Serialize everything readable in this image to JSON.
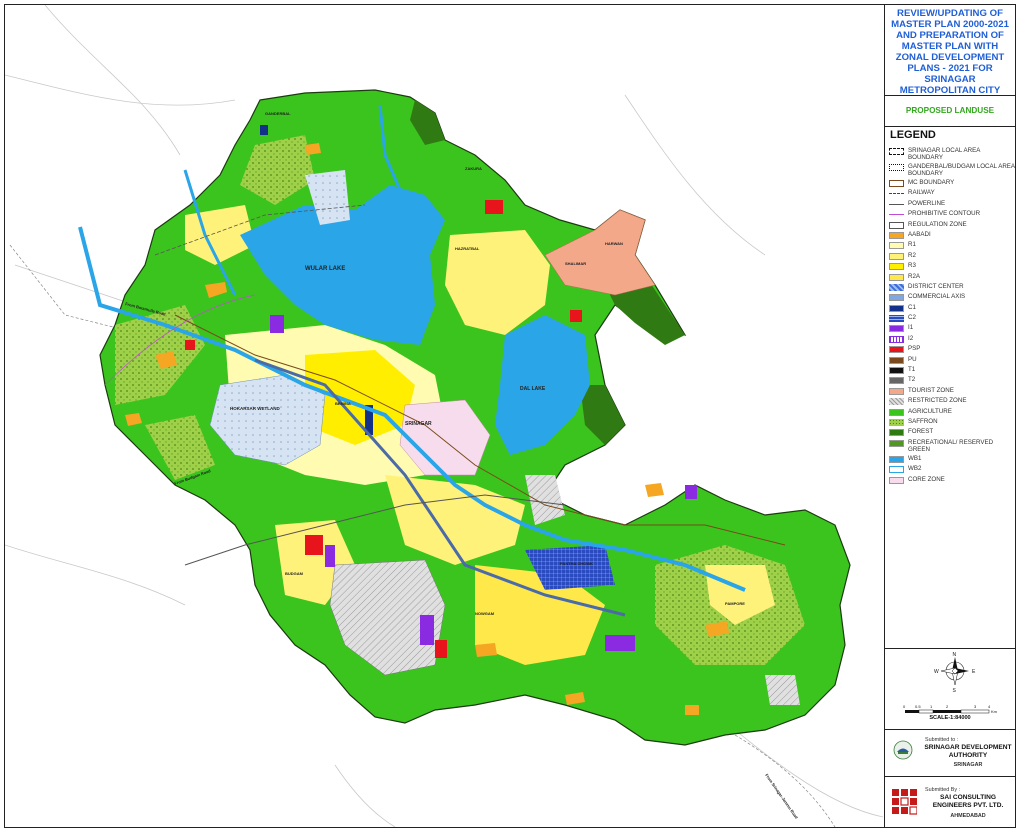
{
  "title": "REVIEW/UPDATING OF MASTER PLAN 2000-2021 AND PREPARATION OF MASTER PLAN WITH ZONAL DEVELOPMENT PLANS - 2021 FOR SRINAGAR METROPOLITAN CITY",
  "title_lines": [
    "REVIEW/UPDATING OF",
    "MASTER PLAN 2000-2021",
    "AND PREPARATION OF",
    "MASTER PLAN WITH",
    "ZONAL DEVELOPMENT",
    "PLANS - 2021 FOR",
    "SRINAGAR",
    "METROPOLITAN CITY"
  ],
  "subtitle": "PROPOSED LANDUSE",
  "legend_heading": "LEGEND",
  "legend": [
    {
      "label": "SRINAGAR LOCAL AREA BOUNDARY",
      "color": "#ffffff",
      "kind": "dashed-box"
    },
    {
      "label": "GANDERBAL/BUDGAM LOCAL AREA BOUNDARY",
      "color": "#ffffff",
      "kind": "dotted-box"
    },
    {
      "label": "MC BOUNDARY",
      "color": "#ffffff",
      "kind": "brown-box"
    },
    {
      "label": "RAILWAY",
      "color": "#444444",
      "kind": "rail"
    },
    {
      "label": "POWERLINE",
      "color": "#555555",
      "kind": "line"
    },
    {
      "label": "PROHIBITIVE CONTOUR",
      "color": "#c24bd6",
      "kind": "line"
    },
    {
      "label": "REGULATION ZONE",
      "color": "#ffffff",
      "kind": "outline-box"
    },
    {
      "label": "AABADI",
      "color": "#f5a623"
    },
    {
      "label": "R1",
      "color": "#fffbb0"
    },
    {
      "label": "R2",
      "color": "#fff27a"
    },
    {
      "label": "R3",
      "color": "#ffee00"
    },
    {
      "label": "R2A",
      "color": "#ffe84a"
    },
    {
      "label": "DISTRICT CENTER",
      "color": "#3a6fd8",
      "kind": "hatch-blue"
    },
    {
      "label": "COMMERCIAL AXIS",
      "color": "#7fa7e0"
    },
    {
      "label": "C1",
      "color": "#14318a"
    },
    {
      "label": "C2",
      "color": "#2a4bc0",
      "kind": "grid-blue"
    },
    {
      "label": "I1",
      "color": "#8a2be2"
    },
    {
      "label": "I2",
      "color": "#ffffff",
      "kind": "grid-purple"
    },
    {
      "label": "PSP",
      "color": "#e8141c"
    },
    {
      "label": "PU",
      "color": "#7a4a1c"
    },
    {
      "label": "T1",
      "color": "#111111"
    },
    {
      "label": "T2",
      "color": "#666666"
    },
    {
      "label": "TOURIST ZONE",
      "color": "#f4a88a"
    },
    {
      "label": "RESTRICTED ZONE",
      "color": "#d8d8d8",
      "kind": "hatch-grey"
    },
    {
      "label": "AGRICULTURE",
      "color": "#3ac41d"
    },
    {
      "label": "SAFFRON",
      "color": "#9ed04a",
      "kind": "dots-green"
    },
    {
      "label": "FOREST",
      "color": "#2f7a12"
    },
    {
      "label": "RECREATIONAL/ RESERVED GREEN",
      "color": "#4f9a1e"
    },
    {
      "label": "WB1",
      "color": "#2aa5e8"
    },
    {
      "label": "WB2",
      "color": "#ffffff",
      "kind": "outline-blue"
    },
    {
      "label": "CORE ZONE",
      "color": "#f6dcec"
    }
  ],
  "compass": {
    "n": "N",
    "s": "S",
    "e": "E",
    "w": "W"
  },
  "scale": {
    "ticks": [
      "0",
      "0.5",
      "1",
      "2",
      "3",
      "4"
    ],
    "unit": "Km",
    "label": "SCALE-1:84000"
  },
  "submitted_to": {
    "prefix": "Submitted to :",
    "org_line1": "SRINAGAR DEVELOPMENT",
    "org_line2": "AUTHORITY",
    "city": "SRINAGAR"
  },
  "submitted_by": {
    "prefix": "Submitted By :",
    "org_line1": "SAI CONSULTING",
    "org_line2": "ENGINEERS PVT. LTD.",
    "city": "AHMEDABAD"
  },
  "map_labels": {
    "lake_1": "WULAR LAKE",
    "lake_2": "DAL LAKE",
    "wetland": "HOKARSAR WETLAND",
    "city_centre": "SRINAGAR",
    "bypass_1": "From Baramulla Road",
    "bypass_2": "From Budgam Road",
    "bypass_3": "From Srinagar-Jammu Road",
    "area_1": "GANDERBAL",
    "area_2": "ZAKURA",
    "area_3": "HAZRATBAL",
    "area_4": "PANTHA CHOWK",
    "area_5": "BEMINA",
    "area_6": "PAMPORE",
    "area_7": "BUDGAM",
    "area_8": "NOWGAM",
    "area_9": "SHALIMAR",
    "area_10": "HARWAN"
  },
  "colors": {
    "title_blue": "#1f5fd6",
    "subtitle_green": "#33a81f",
    "agriculture": "#3ac41d",
    "saffron": "#9ed04a",
    "water": "#2aa5e8",
    "residential": "#fff27a"
  }
}
